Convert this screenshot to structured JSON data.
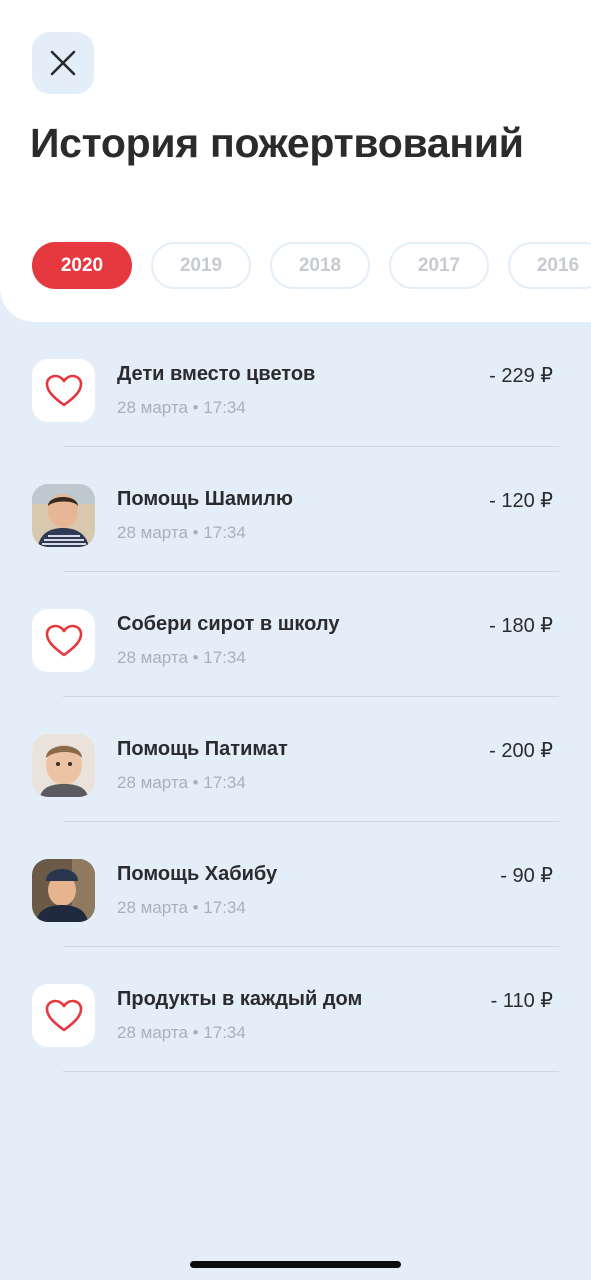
{
  "header": {
    "title": "История пожертвований",
    "close_icon": "close-icon",
    "years": [
      {
        "label": "2020",
        "active": true
      },
      {
        "label": "2019",
        "active": false
      },
      {
        "label": "2018",
        "active": false
      },
      {
        "label": "2017",
        "active": false
      },
      {
        "label": "2016",
        "active": false
      }
    ]
  },
  "donations": [
    {
      "title": "Дети вместо цветов",
      "date": "28 марта • 17:34",
      "amount": "- 229 ₽",
      "avatar": "heart-icon"
    },
    {
      "title": "Помощь Шамилю",
      "date": "28 марта • 17:34",
      "amount": "- 120 ₽",
      "avatar": "child-photo"
    },
    {
      "title": "Собери сирот в школу",
      "date": "28 марта • 17:34",
      "amount": "- 180 ₽",
      "avatar": "heart-icon"
    },
    {
      "title": "Помощь Патимат",
      "date": "28 марта • 17:34",
      "amount": "- 200 ₽",
      "avatar": "child-photo"
    },
    {
      "title": "Помощь Хабибу",
      "date": "28 марта • 17:34",
      "amount": "- 90 ₽",
      "avatar": "child-photo"
    },
    {
      "title": "Продукты в каждый дом",
      "date": "28 марта • 17:34",
      "amount": "- 110 ₽",
      "avatar": "heart-icon"
    }
  ],
  "colors": {
    "accent": "#e5383f",
    "background": "#e4eef8",
    "text": "#2b2b2e",
    "muted": "#aab0b8"
  }
}
